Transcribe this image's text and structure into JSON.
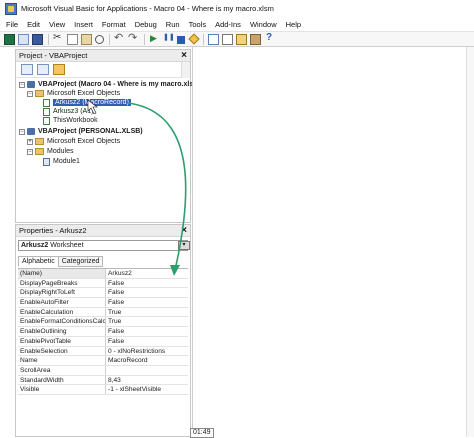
{
  "window": {
    "title": "Microsoft Visual Basic for Applications - Macro 04 - Where is my macro.xlsm"
  },
  "menu": [
    "File",
    "Edit",
    "View",
    "Insert",
    "Format",
    "Debug",
    "Run",
    "Tools",
    "Add-Ins",
    "Window",
    "Help"
  ],
  "toolbar": {
    "icons": [
      "excel-icon",
      "insert-module-icon",
      "save-icon",
      "cut-icon",
      "copy-icon",
      "paste-icon",
      "find-icon",
      "undo-icon",
      "redo-icon",
      "run-icon",
      "break-icon",
      "reset-icon",
      "design-mode-icon",
      "project-explorer-icon",
      "properties-icon",
      "object-browser-icon",
      "toolbox-icon",
      "help-icon"
    ]
  },
  "project_pane": {
    "title": "Project - VBAProject",
    "close": "×",
    "tree": [
      {
        "label": "VBAProject (Macro 04 - Where is my macro.xls",
        "bold": true
      },
      {
        "label": "Microsoft Excel Objects"
      },
      {
        "label": "Arkusz2 (MacroRecord)",
        "selected": true
      },
      {
        "label": "Arkusz3 (Arkusz3)",
        "visible_text": "Arkusz3 (A1)"
      },
      {
        "label": "ThisWorkbook"
      },
      {
        "label": "VBAProject (PERSONAL.XLSB)",
        "bold": true
      },
      {
        "label": "Microsoft Excel Objects"
      },
      {
        "label": "Modules"
      },
      {
        "label": "Module1"
      }
    ]
  },
  "properties_pane": {
    "title": "Properties - Arkusz2",
    "close": "×",
    "object_select": {
      "name": "Arkusz2",
      "type": "Worksheet"
    },
    "tabs": [
      "Alphabetic",
      "Categorized"
    ],
    "rows": [
      {
        "name": "(Name)",
        "value": "Arkusz2"
      },
      {
        "name": "DisplayPageBreaks",
        "value": "False"
      },
      {
        "name": "DisplayRightToLeft",
        "value": "False"
      },
      {
        "name": "EnableAutoFilter",
        "value": "False"
      },
      {
        "name": "EnableCalculation",
        "value": "True"
      },
      {
        "name": "EnableFormatConditionsCalcula",
        "value": "True"
      },
      {
        "name": "EnableOutlining",
        "value": "False"
      },
      {
        "name": "EnablePivotTable",
        "value": "False"
      },
      {
        "name": "EnableSelection",
        "value": "0 - xlNoRestrictions"
      },
      {
        "name": "Name",
        "value": "MacroRecord"
      },
      {
        "name": "ScrollArea",
        "value": ""
      },
      {
        "name": "StandardWidth",
        "value": "8,43"
      },
      {
        "name": "Visible",
        "value": "-1 - xlSheetVisible"
      }
    ]
  },
  "annotation": {
    "arrow_color": "#2e9e6e"
  },
  "timestamp": "01:49"
}
